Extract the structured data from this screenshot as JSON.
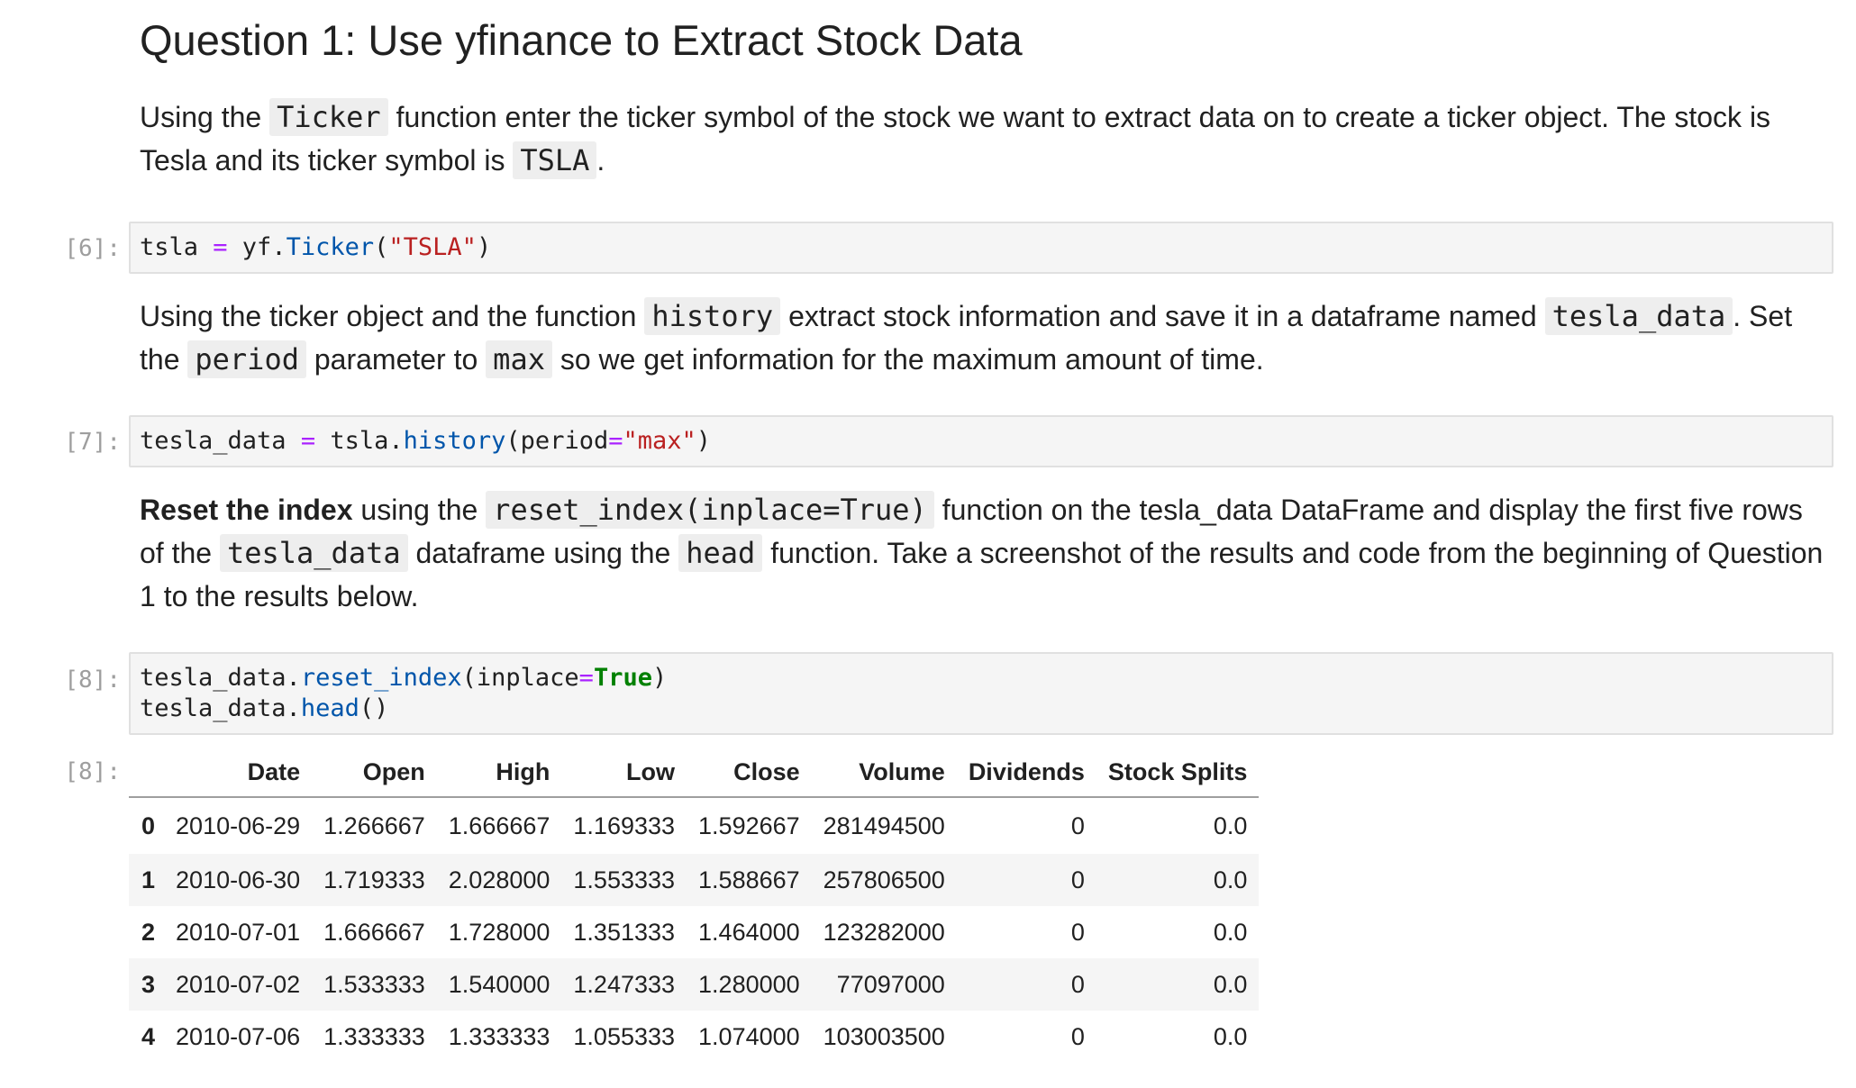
{
  "question": {
    "title": "Question 1: Use yfinance to Extract Stock Data"
  },
  "md1": {
    "t1": "Using the ",
    "c1": "Ticker",
    "t2": " function enter the ticker symbol of the stock we want to extract data on to create a ticker object. The stock is Tesla and its ticker symbol is ",
    "c2": "TSLA",
    "t3": "."
  },
  "cell6": {
    "prompt": "[6]:",
    "var": "tsla ",
    "op": "=",
    "mod": " yf.",
    "fn": "Ticker",
    "open": "(",
    "str": "\"TSLA\"",
    "close": ")"
  },
  "md2": {
    "t1": "Using the ticker object and the function ",
    "c1": "history",
    "t2": " extract stock information and save it in a dataframe named ",
    "c2": "tesla_data",
    "t3": ". Set the ",
    "c3": "period",
    "t4": " parameter to ",
    "c4": "max",
    "t5": " so we get information for the maximum amount of time."
  },
  "cell7": {
    "prompt": "[7]:",
    "var": "tesla_data ",
    "op": "=",
    "mod": " tsla.",
    "fn": "history",
    "open": "(period",
    "op2": "=",
    "str": "\"max\"",
    "close": ")"
  },
  "md3": {
    "b1": "Reset the index",
    "t1": " using the ",
    "c1": "reset_index(inplace=True)",
    "t2": " function on the tesla_data DataFrame and display the first five rows of the ",
    "c2": "tesla_data",
    "t3": " dataframe using the ",
    "c3": "head",
    "t4": " function. Take a screenshot of the results and code from the beginning of Question 1 to the results below."
  },
  "cell8": {
    "prompt": "[8]:",
    "l1_obj": "tesla_data.",
    "l1_fn": "reset_index",
    "l1_open": "(inplace",
    "l1_op": "=",
    "l1_kw": "True",
    "l1_close": ")",
    "l2_obj": "tesla_data.",
    "l2_fn": "head",
    "l2_close": "()"
  },
  "output8": {
    "prompt": "[8]:",
    "columns": [
      "",
      "Date",
      "Open",
      "High",
      "Low",
      "Close",
      "Volume",
      "Dividends",
      "Stock Splits"
    ],
    "rows": [
      [
        "0",
        "2010-06-29",
        "1.266667",
        "1.666667",
        "1.169333",
        "1.592667",
        "281494500",
        "0",
        "0.0"
      ],
      [
        "1",
        "2010-06-30",
        "1.719333",
        "2.028000",
        "1.553333",
        "1.588667",
        "257806500",
        "0",
        "0.0"
      ],
      [
        "2",
        "2010-07-01",
        "1.666667",
        "1.728000",
        "1.351333",
        "1.464000",
        "123282000",
        "0",
        "0.0"
      ],
      [
        "3",
        "2010-07-02",
        "1.533333",
        "1.540000",
        "1.247333",
        "1.280000",
        "77097000",
        "0",
        "0.0"
      ],
      [
        "4",
        "2010-07-06",
        "1.333333",
        "1.333333",
        "1.055333",
        "1.074000",
        "103003500",
        "0",
        "0.0"
      ]
    ]
  }
}
